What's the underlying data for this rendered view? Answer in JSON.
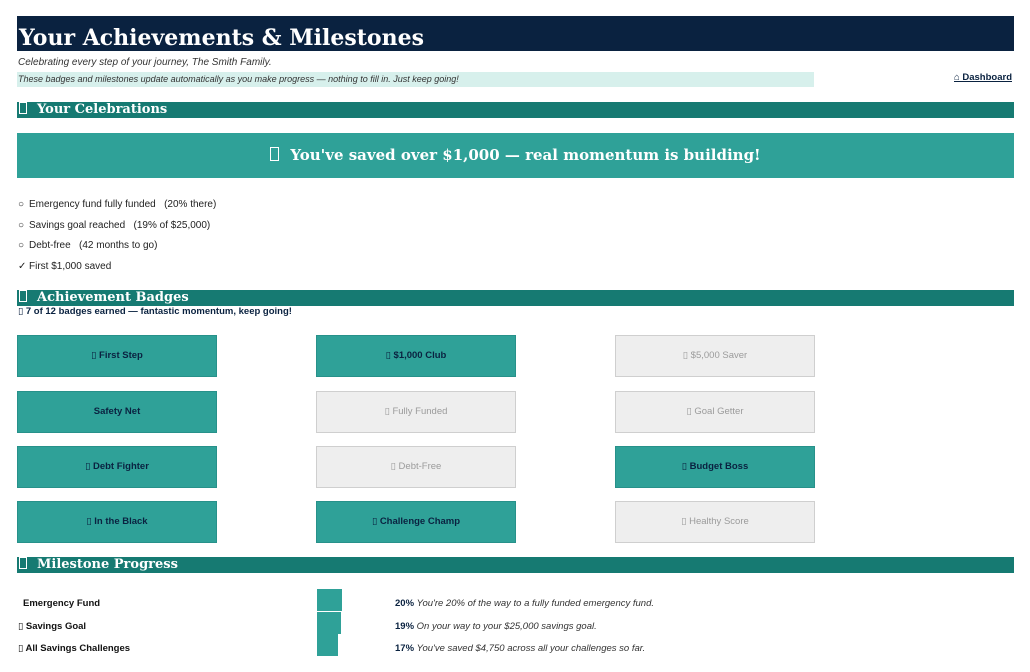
{
  "header": {
    "title": "Your Achievements & Milestones",
    "subtitle": "Celebrating every step of your journey, The Smith Family.",
    "note": "These badges and milestones update automatically as you make progress — nothing to fill in. Just keep going!",
    "dashboard_link": "⌂ Dashboard"
  },
  "celebrations": {
    "heading": "Your Celebrations",
    "banner": "You've saved over $1,000 — real momentum is building!",
    "items": [
      {
        "mark": "○",
        "text": "Emergency fund fully funded   (20% there)"
      },
      {
        "mark": "○",
        "text": "Savings goal reached   (19% of $25,000)"
      },
      {
        "mark": "○",
        "text": "Debt-free   (42 months to go)"
      },
      {
        "mark": "✓",
        "text": "First $1,000 saved"
      }
    ]
  },
  "badges": {
    "heading": "Achievement Badges",
    "summary": "7 of 12 badges earned — fantastic momentum, keep going!",
    "items": [
      {
        "label": "First Step",
        "earned": true
      },
      {
        "label": "$1,000 Club",
        "earned": true
      },
      {
        "label": "$5,000 Saver",
        "earned": false
      },
      {
        "label": "Safety Net",
        "earned": true
      },
      {
        "label": "Fully Funded",
        "earned": false
      },
      {
        "label": "Goal Getter",
        "earned": false
      },
      {
        "label": "Debt Fighter",
        "earned": true
      },
      {
        "label": "Debt-Free",
        "earned": false
      },
      {
        "label": "Budget Boss",
        "earned": true
      },
      {
        "label": "In the Black",
        "earned": true
      },
      {
        "label": "Challenge Champ",
        "earned": true
      },
      {
        "label": "Healthy Score",
        "earned": false
      }
    ]
  },
  "milestones": {
    "heading": "Milestone Progress",
    "items": [
      {
        "label": "Emergency Fund",
        "percent": 20,
        "percent_label": "20%",
        "text": "You're 20% of the way to a fully funded emergency fund."
      },
      {
        "label": "Savings Goal",
        "percent": 19,
        "percent_label": "19%",
        "text": "On your way to your $25,000 savings goal."
      },
      {
        "label": "All Savings Challenges",
        "percent": 17,
        "percent_label": "17%",
        "text": "You've saved $4,750 across all your challenges so far."
      }
    ]
  },
  "colors": {
    "title_bg": "#0a2240",
    "section_bg": "#167a72",
    "accent": "#2fa198",
    "note_bg": "#d7f0ec",
    "locked_bg": "#eeeeee"
  }
}
